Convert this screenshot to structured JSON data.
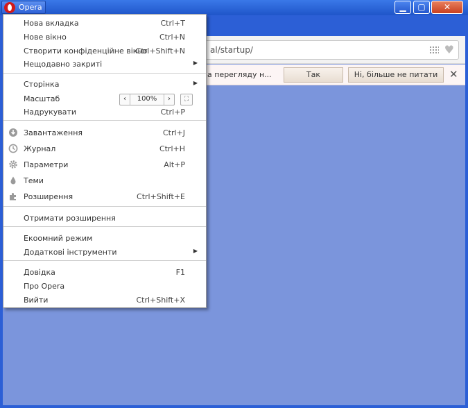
{
  "window": {
    "opera_label": "Opera",
    "min": "▁",
    "max": "▢",
    "close": "✕"
  },
  "address": {
    "text": "al/startup/",
    "grid_icon": "speed-dial-icon",
    "heart_icon": "heart-icon",
    "heart_glyph": "♥"
  },
  "infobar": {
    "text": "а перегляду н...",
    "yes_label": "Так",
    "no_label": "Ні, більше не питати",
    "close_glyph": "✕"
  },
  "menu": {
    "new_tab": {
      "label": "Нова вкладка",
      "shortcut": "Ctrl+T"
    },
    "new_window": {
      "label": "Нове вікно",
      "shortcut": "Ctrl+N"
    },
    "private_window": {
      "label": "Створити конфіденційне вікно",
      "shortcut": "Ctrl+Shift+N"
    },
    "recently_closed": {
      "label": "Нещодавно закриті"
    },
    "page": {
      "label": "Сторінка"
    },
    "zoom": {
      "label": "Масштаб",
      "value": "100%",
      "minus": "‹",
      "plus": "›",
      "fullscreen": "⛶"
    },
    "print": {
      "label": "Надрукувати",
      "shortcut": "Ctrl+P"
    },
    "downloads": {
      "label": "Завантаження",
      "shortcut": "Ctrl+J"
    },
    "history": {
      "label": "Журнал",
      "shortcut": "Ctrl+H"
    },
    "settings": {
      "label": "Параметри",
      "shortcut": "Alt+P"
    },
    "themes": {
      "label": "Теми"
    },
    "extensions": {
      "label": "Розширення",
      "shortcut": "Ctrl+Shift+E"
    },
    "get_extensions": {
      "label": "Отримати розширення"
    },
    "turbo": {
      "label": "Екоомний режим"
    },
    "more_tools": {
      "label": "Додаткові інструменти"
    },
    "help": {
      "label": "Довідка",
      "shortcut": "F1"
    },
    "about": {
      "label": "Про Opera"
    },
    "exit": {
      "label": "Вийти",
      "shortcut": "Ctrl+Shift+X"
    },
    "submenu_arrow": "▶"
  }
}
